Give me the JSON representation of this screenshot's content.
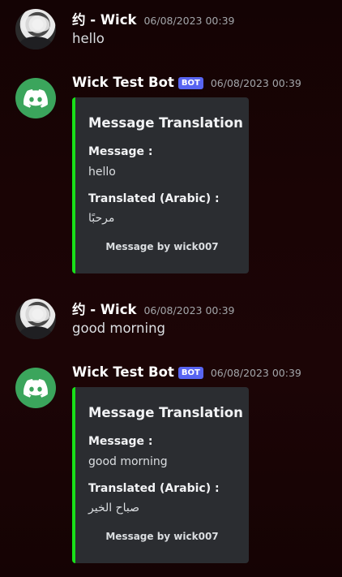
{
  "messages": [
    {
      "author": "约 - Wick",
      "timestamp": "06/08/2023 00:39",
      "avatar_icon": "user-avatar",
      "text": "hello"
    },
    {
      "author": "Wick Test Bot",
      "badge": "BOT",
      "timestamp": "06/08/2023 00:39",
      "avatar_icon": "discord-logo-icon",
      "embed": {
        "accent_color": "#19e019",
        "title": "Message Translation",
        "fields": [
          {
            "name": "Message :",
            "value": "hello"
          },
          {
            "name": "Translated (Arabic) :",
            "value": "مرحبًا"
          }
        ],
        "footer": "Message by wick007"
      }
    },
    {
      "author": "约 - Wick",
      "timestamp": "06/08/2023 00:39",
      "avatar_icon": "user-avatar",
      "text": "good morning"
    },
    {
      "author": "Wick Test Bot",
      "badge": "BOT",
      "timestamp": "06/08/2023 00:39",
      "avatar_icon": "discord-logo-icon",
      "embed": {
        "accent_color": "#19e019",
        "title": "Message Translation",
        "fields": [
          {
            "name": "Message :",
            "value": "good morning"
          },
          {
            "name": "Translated (Arabic) :",
            "value": "صباح الخير"
          }
        ],
        "footer": "Message by wick007"
      }
    }
  ],
  "colors": {
    "bot_badge": "#5865f2",
    "bot_avatar": "#3ba55c",
    "embed_background": "#2b2d31"
  }
}
